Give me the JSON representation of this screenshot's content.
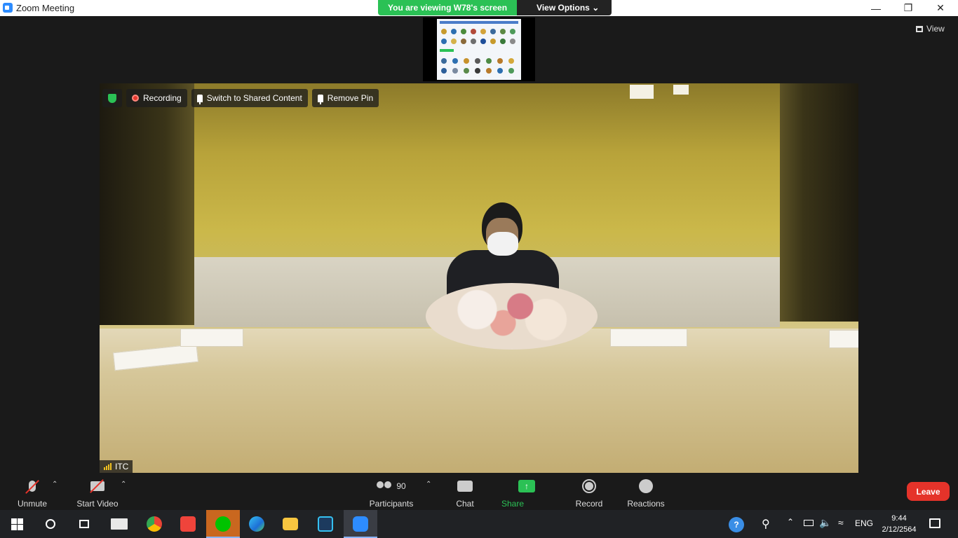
{
  "window": {
    "title": "Zoom Meeting"
  },
  "banner": {
    "viewing_text": "You are viewing W78's screen",
    "view_options_label": "View Options"
  },
  "view_button": {
    "label": "View"
  },
  "video_overlay": {
    "recording_label": "Recording",
    "switch_label": "Switch to Shared Content",
    "remove_pin_label": "Remove Pin",
    "participant_name": "ITC"
  },
  "controls": {
    "unmute_label": "Unmute",
    "start_video_label": "Start Video",
    "participants_label": "Participants",
    "participants_count": "90",
    "chat_label": "Chat",
    "share_screen_label": "Share Screen",
    "record_label": "Record",
    "reactions_label": "Reactions",
    "leave_label": "Leave"
  },
  "taskbar": {
    "language": "ENG",
    "time": "9:44",
    "date": "2/12/2564"
  },
  "colors": {
    "accent_green": "#2bc155",
    "leave_red": "#e5332a",
    "zoom_blue": "#2d8cff"
  }
}
